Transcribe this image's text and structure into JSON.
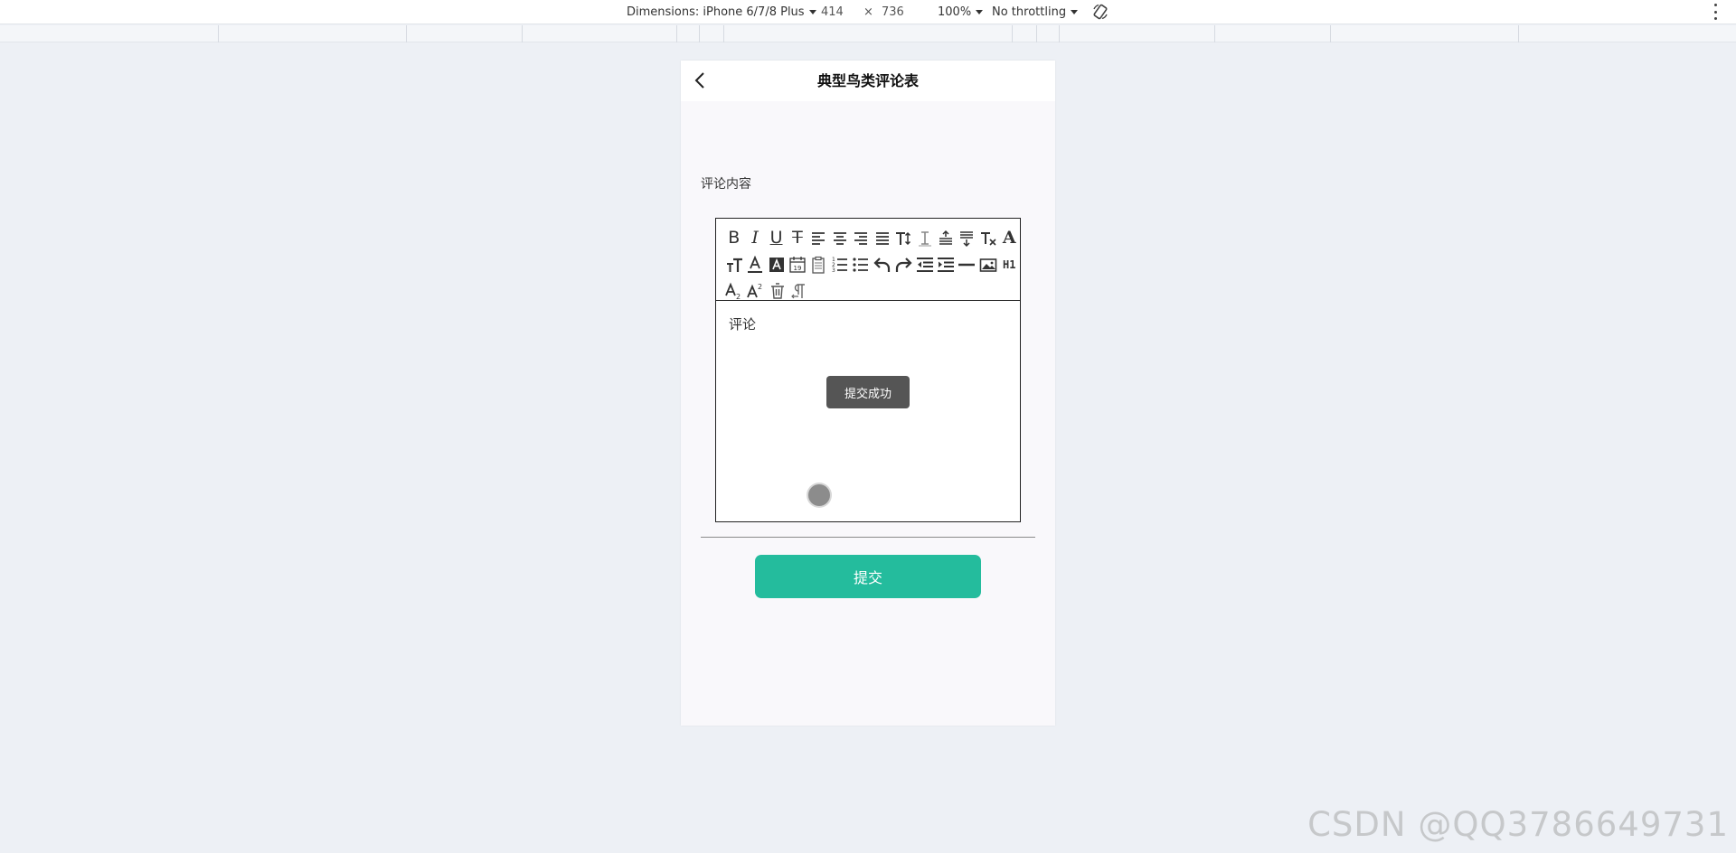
{
  "devtools": {
    "dimensions_label": "Dimensions: iPhone 6/7/8 Plus",
    "width": "414",
    "times": "×",
    "height": "736",
    "zoom": "100%",
    "throttling": "No throttling"
  },
  "page": {
    "title": "典型鸟类评论表",
    "field_label": "评论内容",
    "editor_content": "评论",
    "toast": "提交成功",
    "submit_label": "提交"
  },
  "toolbar": {
    "row1": [
      "bold-icon",
      "italic-icon",
      "underline-icon",
      "strikethrough-icon",
      "align-left-icon",
      "align-center-icon",
      "align-right-icon",
      "align-justify-icon",
      "font-size-icon",
      "line-height-icon",
      "indent-top-icon",
      "indent-bottom-icon",
      "clear-format-icon",
      "font-family-icon"
    ],
    "row2": [
      "text-size-icon",
      "font-color-icon",
      "background-color-icon",
      "date-icon",
      "clipboard-icon",
      "ordered-list-icon",
      "unordered-list-icon",
      "undo-icon",
      "redo-icon",
      "outdent-icon",
      "indent-icon",
      "horizontal-rule-icon",
      "image-icon",
      "heading-icon"
    ],
    "row3": [
      "subscript-icon",
      "superscript-icon",
      "delete-icon",
      "paragraph-icon"
    ],
    "heading_text": "H1"
  },
  "watermark": "CSDN @QQ3786649731",
  "colors": {
    "accent": "#24bc9d",
    "toast_bg": "#555555",
    "page_bg": "#edf0f5"
  }
}
